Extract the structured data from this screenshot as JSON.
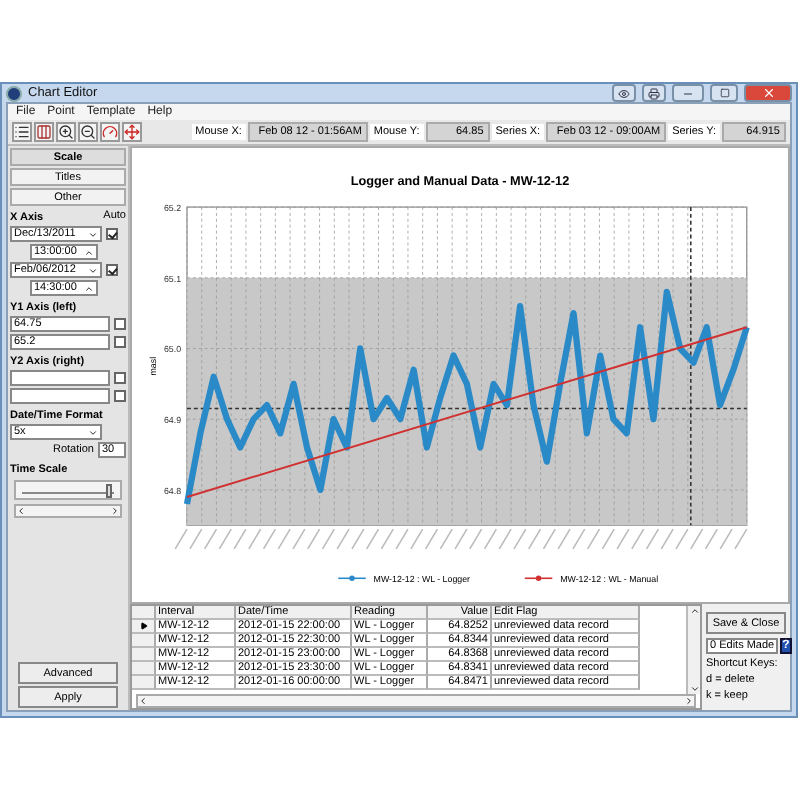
{
  "window": {
    "title": "Chart Editor"
  },
  "menu": [
    "File",
    "Point",
    "Template",
    "Help"
  ],
  "toolbar": {
    "readouts": [
      {
        "label": "Mouse X:",
        "value": "Feb 08 12 - 01:56AM"
      },
      {
        "label": "Mouse Y:",
        "value": "64.85"
      },
      {
        "label": "Series X:",
        "value": "Feb 03 12 - 09:00AM"
      },
      {
        "label": "Series Y:",
        "value": "64.915"
      }
    ]
  },
  "side_panel": {
    "tabs": [
      {
        "label": "Scale",
        "selected": true
      },
      {
        "label": "Titles",
        "selected": false
      },
      {
        "label": "Other",
        "selected": false
      }
    ],
    "x_axis": {
      "title": "X Axis",
      "auto_label": "Auto",
      "start_date": "Dec/13/2011",
      "start_time": "13:00:00",
      "start_checked": true,
      "end_date": "Feb/06/2012",
      "end_time": "14:30:00",
      "end_checked": true
    },
    "y1_axis": {
      "title": "Y1 Axis (left)",
      "min": "64.75",
      "min_checked": false,
      "max": "65.2",
      "max_checked": false
    },
    "y2_axis": {
      "title": "Y2 Axis (right)",
      "min_checked": false,
      "max_checked": false
    },
    "date_format": {
      "title": "Date/Time Format",
      "value": "5x",
      "rotation_label": "Rotation",
      "rotation": "30"
    },
    "time_scale": {
      "title": "Time Scale",
      "level": 0.95
    },
    "buttons": [
      "Advanced",
      "Apply"
    ]
  },
  "chart": {
    "chart_data": {
      "type": "line",
      "title": "Logger and Manual Data - MW-12-12",
      "ylabel": "masl",
      "ylim": [
        64.75,
        65.2
      ],
      "yticks": [
        {
          "value": 64.8,
          "label": "64.8"
        },
        {
          "value": 64.9,
          "label": "64.9"
        },
        {
          "value": 65.0,
          "label": "65.0"
        },
        {
          "value": 65.1,
          "label": "65.1"
        },
        {
          "value": 65.2,
          "label": "65.2"
        }
      ],
      "grid": true,
      "legend": true,
      "bands": [
        {
          "axis": "y",
          "from": 64.75,
          "to": 65.1
        }
      ],
      "ref_lines": [
        {
          "axis": "y",
          "value": 64.915
        }
      ],
      "series": [
        {
          "name": "MW-12-12 : WL - Logger",
          "color": "#2a8ac8",
          "values": [
            64.78,
            64.88,
            64.96,
            64.9,
            64.86,
            64.9,
            64.92,
            64.88,
            64.95,
            64.86,
            64.8,
            64.9,
            64.86,
            65.0,
            64.9,
            64.93,
            64.9,
            64.97,
            64.86,
            64.93,
            64.99,
            64.95,
            64.86,
            64.95,
            64.92,
            65.06,
            64.92,
            64.84,
            64.95,
            65.05,
            64.88,
            64.99,
            64.9,
            64.88,
            65.03,
            64.9,
            65.08,
            65.0,
            64.98,
            65.03,
            64.92,
            64.97,
            65.03
          ]
        },
        {
          "name": "MW-12-12 : WL - Manual",
          "color": "#d03030",
          "values": [
            64.79,
            null,
            null,
            null,
            null,
            null,
            null,
            null,
            null,
            null,
            null,
            null,
            null,
            null,
            null,
            null,
            null,
            null,
            null,
            null,
            null,
            null,
            null,
            null,
            null,
            null,
            null,
            null,
            null,
            null,
            null,
            null,
            null,
            null,
            null,
            null,
            null,
            null,
            null,
            null,
            null,
            null,
            65.03
          ]
        }
      ]
    }
  },
  "table": {
    "columns": [
      "Interval",
      "Date/Time",
      "Reading",
      "Value",
      "Edit Flag"
    ],
    "rows": [
      {
        "selected": true,
        "cells": [
          "MW-12-12",
          "2012-01-15 22:00:00",
          "WL - Logger",
          "64.8252",
          "unreviewed data record"
        ]
      },
      {
        "selected": false,
        "cells": [
          "MW-12-12",
          "2012-01-15 22:30:00",
          "WL - Logger",
          "64.8344",
          "unreviewed data record"
        ]
      },
      {
        "selected": false,
        "cells": [
          "MW-12-12",
          "2012-01-15 23:00:00",
          "WL - Logger",
          "64.8368",
          "unreviewed data record"
        ]
      },
      {
        "selected": false,
        "cells": [
          "MW-12-12",
          "2012-01-15 23:30:00",
          "WL - Logger",
          "64.8341",
          "unreviewed data record"
        ]
      },
      {
        "selected": false,
        "cells": [
          "MW-12-12",
          "2012-01-16 00:00:00",
          "WL - Logger",
          "64.8471",
          "unreviewed data record"
        ]
      }
    ]
  },
  "actions": {
    "save": "Save & Close",
    "edits": "0 Edits Made",
    "help": "?",
    "shortcuts": [
      "Shortcut Keys:",
      "d = delete",
      "k = keep"
    ]
  }
}
